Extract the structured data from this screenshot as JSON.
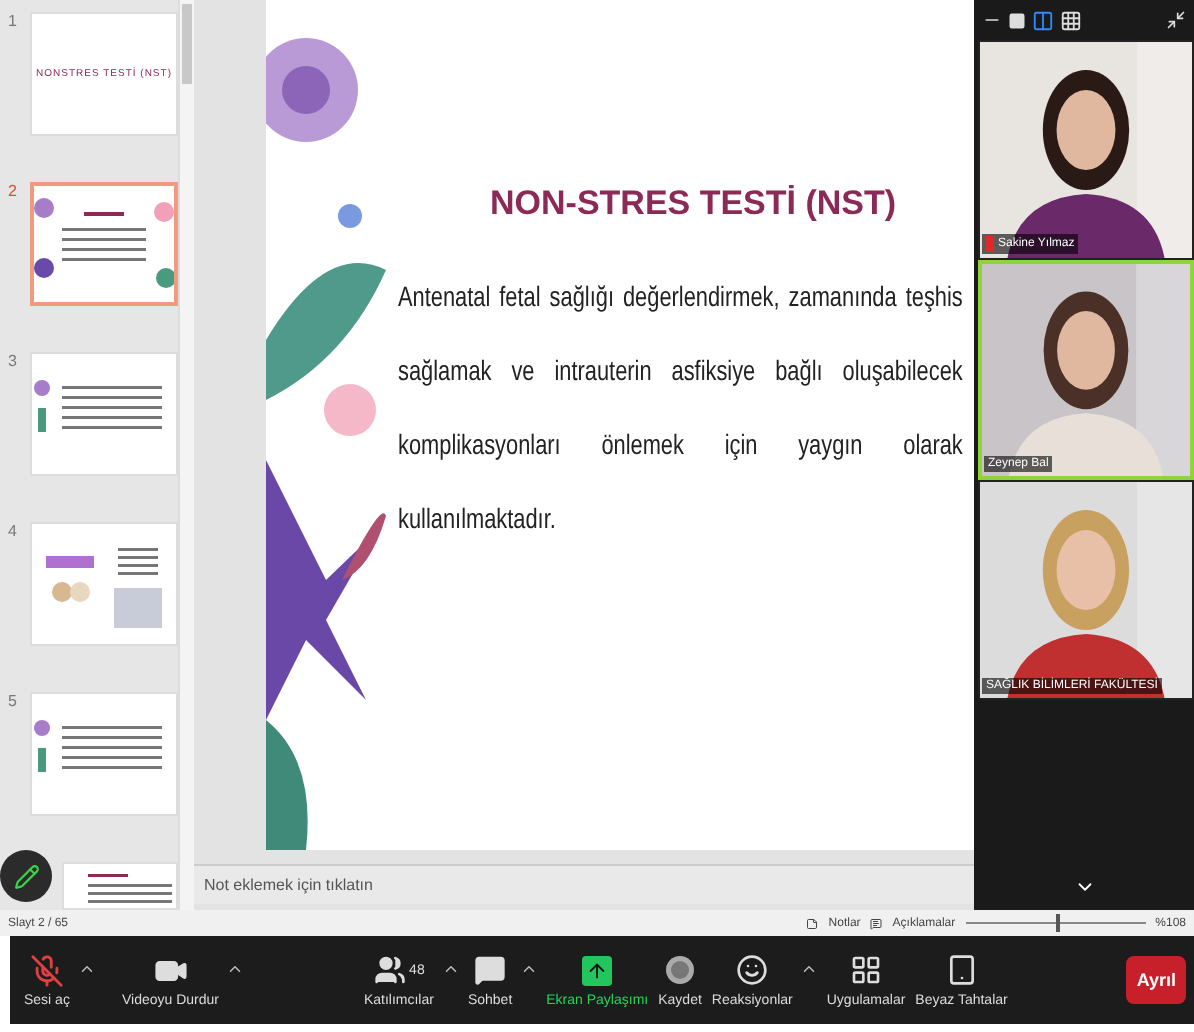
{
  "thumbnails": [
    {
      "number": "1",
      "selected": false,
      "title": "NONSTRES TESTİ (NST)",
      "kind": "title"
    },
    {
      "number": "2",
      "selected": true,
      "kind": "flowers"
    },
    {
      "number": "3",
      "selected": false,
      "kind": "text"
    },
    {
      "number": "4",
      "selected": false,
      "kind": "images"
    },
    {
      "number": "5",
      "selected": false,
      "kind": "text"
    },
    {
      "selected": false,
      "kind": "cut"
    }
  ],
  "slide": {
    "title": "NON-STRES TESTİ (NST)",
    "body": "Antenatal fetal sağlığı değerlendirmek, zamanında teşhis sağlamak ve intrauterin asfiksiye bağlı oluşabilecek komplikasyonları önlemek için yaygın olarak kullanılmaktadır."
  },
  "notes": {
    "placeholder": "Not eklemek için tıklatın"
  },
  "status_bar": {
    "slide_counter": "Slayt 2 / 65",
    "notes": "Notlar",
    "comments": "Açıklamalar",
    "zoom": {
      "level": 0.5
    },
    "zoom_reading": "%108"
  },
  "video_views": [
    {
      "kind": "minimize",
      "selected": false
    },
    {
      "kind": "single",
      "selected": false
    },
    {
      "kind": "speaker",
      "selected": true
    },
    {
      "kind": "grid",
      "selected": false
    }
  ],
  "videos": [
    {
      "name": "Sakine Yılmaz",
      "muted": true,
      "speaking": false,
      "kind": "dark"
    },
    {
      "name": "Zeynep Bal",
      "muted": false,
      "speaking": true,
      "kind": "brown"
    },
    {
      "name": "SAĞLIK BİLİMLERİ FAKÜLTESİ",
      "muted": false,
      "speaking": false,
      "kind": "blond"
    }
  ],
  "toolbar_left": [
    {
      "kind": "mic",
      "label": "Sesi aç",
      "off": true,
      "caret": true
    },
    {
      "kind": "video",
      "label": "Videoyu Durdur",
      "caret": true
    }
  ],
  "toolbar_center": [
    {
      "kind": "participants",
      "label": "Katılımcılar",
      "count": "48",
      "caret": true
    },
    {
      "kind": "chat",
      "label": "Sohbet",
      "caret": true
    },
    {
      "kind": "share",
      "label": "Ekran Paylaşımı",
      "active": true
    },
    {
      "kind": "record",
      "label": "Kaydet"
    },
    {
      "kind": "reactions",
      "label": "Reaksiyonlar",
      "caret": true
    },
    {
      "kind": "apps",
      "label": "Uygulamalar"
    },
    {
      "kind": "whiteboard",
      "label": "Beyaz Tahtalar"
    }
  ],
  "leave_button": "Ayrıl"
}
